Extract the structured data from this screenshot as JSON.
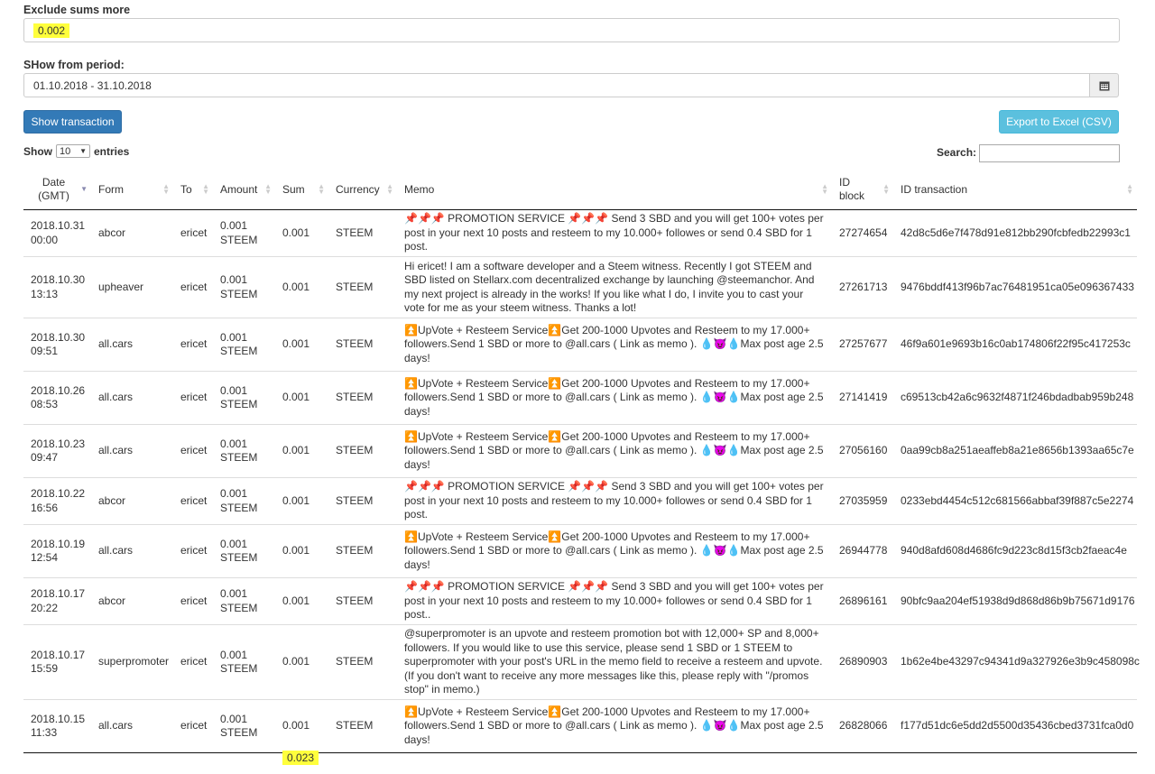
{
  "filters": {
    "exclude_label": "Exclude sums more",
    "exclude_value": "0.002",
    "period_label": "SHow from period:",
    "period_value": "01.10.2018 - 31.10.2018",
    "calendar_icon": "calendar-icon"
  },
  "buttons": {
    "show_transaction": "Show transaction",
    "export": "Export to Excel (CSV)"
  },
  "table_controls": {
    "show": "Show",
    "entries_value": "10",
    "entries": "entries",
    "search": "Search:"
  },
  "columns": [
    "Date (GMT)",
    "Form",
    "To",
    "Amount",
    "Sum",
    "Currency",
    "Memo",
    "ID block",
    "ID transaction"
  ],
  "rows": [
    {
      "date": "2018.10.31 00:00",
      "from": "abcor",
      "to": "ericet",
      "amount": "0.001 STEEM",
      "sum": "0.001",
      "currency": "STEEM",
      "memo": "📌📌📌 PROMOTION SERVICE 📌📌📌 Send 3 SBD and you will get 100+ votes per post in your next 10 posts and resteem to my 10.000+ followes or send 0.4 SBD for 1 post.",
      "block": "27274654",
      "tx": "42d8c5d6e7f478d91e812bb290fcbfedb22993c1"
    },
    {
      "date": "2018.10.30 13:13",
      "from": "upheaver",
      "to": "ericet",
      "amount": "0.001 STEEM",
      "sum": "0.001",
      "currency": "STEEM",
      "memo": "Hi ericet! I am a software developer and a Steem witness. Recently I got STEEM and SBD listed on Stellarx.com decentralized exchange by launching @steemanchor. And my next project is already in the works! If you like what I do, I invite you to cast your vote for me as your steem witness. Thanks a lot!",
      "block": "27261713",
      "tx": "9476bddf413f96b7ac76481951ca05e096367433"
    },
    {
      "date": "2018.10.30 09:51",
      "from": "all.cars",
      "to": "ericet",
      "amount": "0.001 STEEM",
      "sum": "0.001",
      "currency": "STEEM",
      "memo": "⏫UpVote + Resteem Service⏫Get 200-1000 Upvotes and Resteem to my 17.000+ followers.Send 1 SBD or more to @all.cars ( Link as memo ). 💧😈💧Max post age 2.5 days!",
      "block": "27257677",
      "tx": "46f9a601e9693b16c0ab174806f22f95c417253c"
    },
    {
      "date": "2018.10.26 08:53",
      "from": "all.cars",
      "to": "ericet",
      "amount": "0.001 STEEM",
      "sum": "0.001",
      "currency": "STEEM",
      "memo": "⏫UpVote + Resteem Service⏫Get 200-1000 Upvotes and Resteem to my 17.000+ followers.Send 1 SBD or more to @all.cars ( Link as memo ). 💧😈💧Max post age 2.5 days!",
      "block": "27141419",
      "tx": "c69513cb42a6c9632f4871f246bdadbab959b248"
    },
    {
      "date": "2018.10.23 09:47",
      "from": "all.cars",
      "to": "ericet",
      "amount": "0.001 STEEM",
      "sum": "0.001",
      "currency": "STEEM",
      "memo": "⏫UpVote + Resteem Service⏫Get 200-1000 Upvotes and Resteem to my 17.000+ followers.Send 1 SBD or more to @all.cars ( Link as memo ). 💧😈💧Max post age 2.5 days!",
      "block": "27056160",
      "tx": "0aa99cb8a251aeaffeb8a21e8656b1393aa65c7e"
    },
    {
      "date": "2018.10.22 16:56",
      "from": "abcor",
      "to": "ericet",
      "amount": "0.001 STEEM",
      "sum": "0.001",
      "currency": "STEEM",
      "memo": "📌📌📌 PROMOTION SERVICE 📌📌📌 Send 3 SBD and you will get 100+ votes per post in your next 10 posts and resteem to my 10.000+ followes or send 0.4 SBD for 1 post.",
      "block": "27035959",
      "tx": "0233ebd4454c512c681566abbaf39f887c5e2274"
    },
    {
      "date": "2018.10.19 12:54",
      "from": "all.cars",
      "to": "ericet",
      "amount": "0.001 STEEM",
      "sum": "0.001",
      "currency": "STEEM",
      "memo": "⏫UpVote + Resteem Service⏫Get 200-1000 Upvotes and Resteem to my 17.000+ followers.Send 1 SBD or more to @all.cars ( Link as memo ). 💧😈💧Max post age 2.5 days!",
      "block": "26944778",
      "tx": "940d8afd608d4686fc9d223c8d15f3cb2faeac4e"
    },
    {
      "date": "2018.10.17 20:22",
      "from": "abcor",
      "to": "ericet",
      "amount": "0.001 STEEM",
      "sum": "0.001",
      "currency": "STEEM",
      "memo": "📌📌📌 PROMOTION SERVICE 📌📌📌 Send 3 SBD and you will get 100+ votes per post in your next 10 posts and resteem to my 10.000+ followes or send 0.4 SBD for 1 post..",
      "block": "26896161",
      "tx": "90bfc9aa204ef51938d9d868d86b9b75671d9176"
    },
    {
      "date": "2018.10.17 15:59",
      "from": "superpromoter",
      "to": "ericet",
      "amount": "0.001 STEEM",
      "sum": "0.001",
      "currency": "STEEM",
      "memo": "@superpromoter is an upvote and resteem promotion bot with 12,000+ SP and 8,000+ followers. If you would like to use this service, please send 1 SBD or 1 STEEM to superpromoter with your post's URL in the memo field to receive a resteem and upvote. (If you don't want to receive any more messages like this, please reply with \"/promos stop\" in memo.)",
      "block": "26890903",
      "tx": "1b62e4be43297c94341d9a327926e3b9c458098c"
    },
    {
      "date": "2018.10.15 11:33",
      "from": "all.cars",
      "to": "ericet",
      "amount": "0.001 STEEM",
      "sum": "0.001",
      "currency": "STEEM",
      "memo": "⏫UpVote + Resteem Service⏫Get 200-1000 Upvotes and Resteem to my 17.000+ followers.Send 1 SBD or more to @all.cars ( Link as memo ). 💧😈💧Max post age 2.5 days!",
      "block": "26828066",
      "tx": "f177d51dc6e5dd2d5500d35436cbed3731fca0d0"
    }
  ],
  "total_sum": "0.023"
}
